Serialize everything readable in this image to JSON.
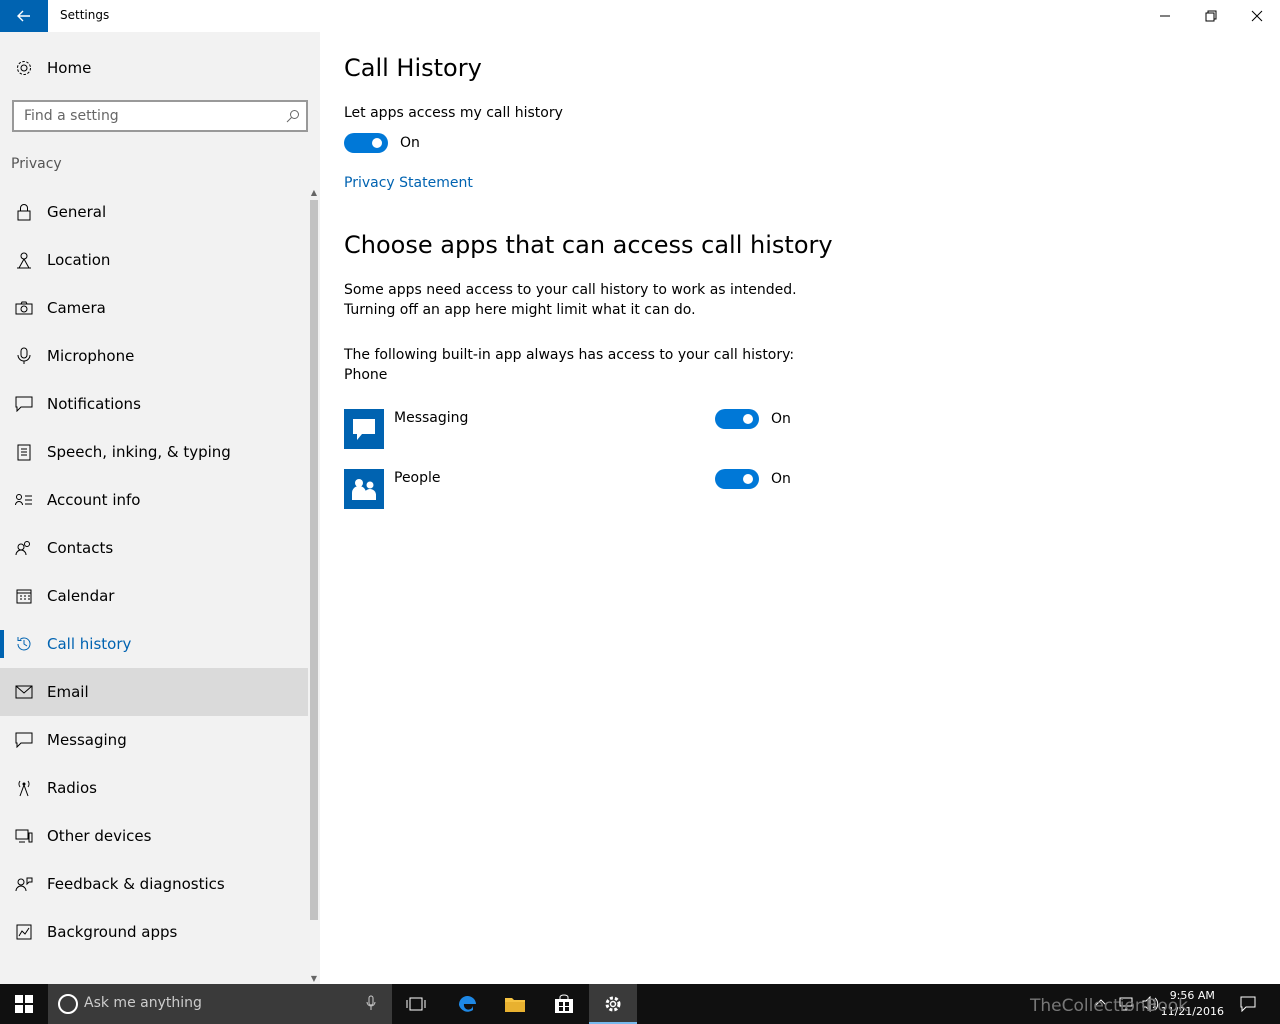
{
  "window": {
    "title": "Settings"
  },
  "sidebar": {
    "home_label": "Home",
    "search_placeholder": "Find a setting",
    "section": "Privacy",
    "items": [
      {
        "label": "General",
        "icon": "lock-icon"
      },
      {
        "label": "Location",
        "icon": "location-icon"
      },
      {
        "label": "Camera",
        "icon": "camera-icon"
      },
      {
        "label": "Microphone",
        "icon": "microphone-icon"
      },
      {
        "label": "Notifications",
        "icon": "notifications-icon"
      },
      {
        "label": "Speech, inking, & typing",
        "icon": "clipboard-icon"
      },
      {
        "label": "Account info",
        "icon": "account-info-icon"
      },
      {
        "label": "Contacts",
        "icon": "contacts-icon"
      },
      {
        "label": "Calendar",
        "icon": "calendar-icon"
      },
      {
        "label": "Call history",
        "icon": "history-icon",
        "active": true
      },
      {
        "label": "Email",
        "icon": "mail-icon",
        "hover": true
      },
      {
        "label": "Messaging",
        "icon": "message-icon"
      },
      {
        "label": "Radios",
        "icon": "radio-tower-icon"
      },
      {
        "label": "Other devices",
        "icon": "devices-icon"
      },
      {
        "label": "Feedback & diagnostics",
        "icon": "feedback-icon"
      },
      {
        "label": "Background apps",
        "icon": "background-apps-icon"
      }
    ]
  },
  "main": {
    "title": "Call History",
    "let_apps_label": "Let apps access my call history",
    "main_toggle": {
      "state": "On",
      "on": true
    },
    "privacy_link": "Privacy Statement",
    "choose_heading": "Choose apps that can access call history",
    "desc_line1": "Some apps need access to your call history to work as intended.",
    "desc_line2": "Turning off an app here might limit what it can do.",
    "builtin_line1": "The following built-in app always has access to your call history:",
    "builtin_line2": "Phone",
    "apps": [
      {
        "name": "Messaging",
        "state": "On",
        "on": true,
        "icon": "messaging-app-icon"
      },
      {
        "name": "People",
        "state": "On",
        "on": true,
        "icon": "people-app-icon"
      }
    ]
  },
  "taskbar": {
    "search_placeholder": "Ask me anything",
    "time": "9:56 AM",
    "date": "11/21/2016",
    "watermark": "TheCollectionBook"
  },
  "colors": {
    "accent": "#0078d7",
    "accent_dark": "#0063b1",
    "sidebar_bg": "#f2f2f2"
  }
}
